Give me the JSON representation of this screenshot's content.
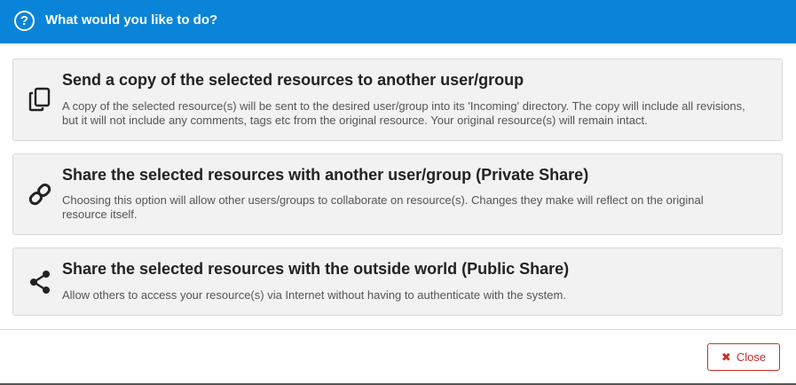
{
  "dialog": {
    "title": "What would you like to do?",
    "help_icon": "question-circle-icon",
    "accent_color": "#0a84d8"
  },
  "options": [
    {
      "icon": "copy-icon",
      "title": "Send a copy of the selected resources to another user/group",
      "description": "A copy of the selected resource(s) will be sent to the desired user/group into its 'Incoming' directory. The copy will include all revisions, but it will not include any comments, tags etc from the original resource. Your original resource(s) will remain intact."
    },
    {
      "icon": "link-icon",
      "title": "Share the selected resources with another user/group (Private Share)",
      "description": "Choosing this option will allow other users/groups to collaborate on resource(s). Changes they make will reflect on the original resource itself."
    },
    {
      "icon": "share-icon",
      "title": "Share the selected resources with the outside world (Public Share)",
      "description": "Allow others to access your resource(s) via Internet without having to authenticate with the system."
    }
  ],
  "footer": {
    "close_label": "Close",
    "close_icon": "times-icon",
    "close_color": "#c9302c"
  }
}
